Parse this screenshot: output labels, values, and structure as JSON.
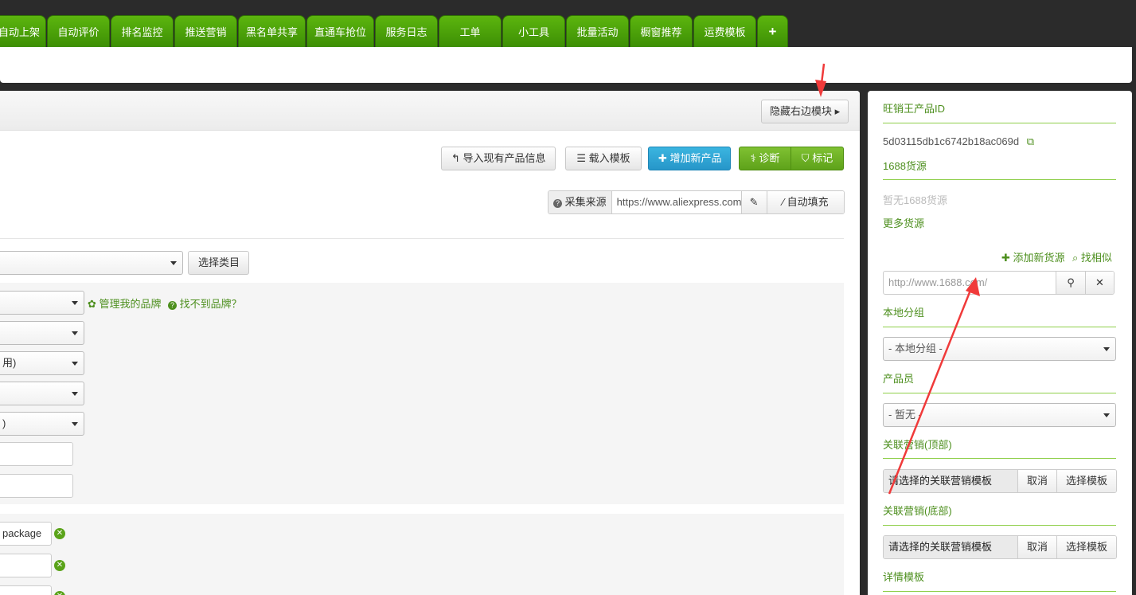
{
  "tabs": [
    {
      "label": "自动上架"
    },
    {
      "label": "自动评价"
    },
    {
      "label": "排名监控"
    },
    {
      "label": "推送营销"
    },
    {
      "label": "黑名单共享"
    },
    {
      "label": "直通车抢位"
    },
    {
      "label": "服务日志"
    },
    {
      "label": "工单"
    },
    {
      "label": "小工具"
    },
    {
      "label": "批量活动"
    },
    {
      "label": "橱窗推荐"
    },
    {
      "label": "运费模板"
    },
    {
      "label": "+"
    }
  ],
  "header": {
    "hide_right_label": "隐藏右边模块 ▸"
  },
  "toolbar": {
    "import_label": "导入现有产品信息",
    "load_template_label": "载入模板",
    "add_product_label": "增加新产品",
    "diagnose_label": "诊断",
    "mark_label": "标记"
  },
  "source": {
    "label": "采集来源",
    "url": "https://www.aliexpress.com",
    "autofill_label": "自动填充"
  },
  "category": {
    "select_label": "选择类目"
  },
  "brand": {
    "manage_label": "管理我的品牌",
    "missing_label": "找不到品牌？"
  },
  "form": {
    "selects": [
      "",
      "",
      "用)",
      "",
      ")"
    ],
    "package_value": "package"
  },
  "side": {
    "pid_title": "旺销王产品ID",
    "pid_value": "5d03115db1c6742b18ac069d",
    "source_title": "1688货源",
    "no_source": "暂无1688货源",
    "more_source": "更多货源",
    "add_source": "添加新货源",
    "find_similar": "找相似",
    "url_placeholder": "http://www.1688.com/",
    "local_group_title": "本地分组",
    "local_group_value": "- 本地分组 -",
    "staff_title": "产品员",
    "staff_value": "- 暂无 -",
    "rel_top_title": "关联营销(顶部)",
    "rel_top_value": "请选择的关联营销模板",
    "cancel_label": "取消",
    "choose_template_label": "选择模板",
    "rel_bottom_title": "关联营销(底部)",
    "rel_bottom_value": "请选择的关联营销模板",
    "detail_title": "详情模板"
  },
  "colors": {
    "tab_green": "#4ca10d",
    "accent_blue": "#2a9fd6",
    "link_green": "#4d8f1e",
    "annotation_red": "#f03a3a"
  }
}
